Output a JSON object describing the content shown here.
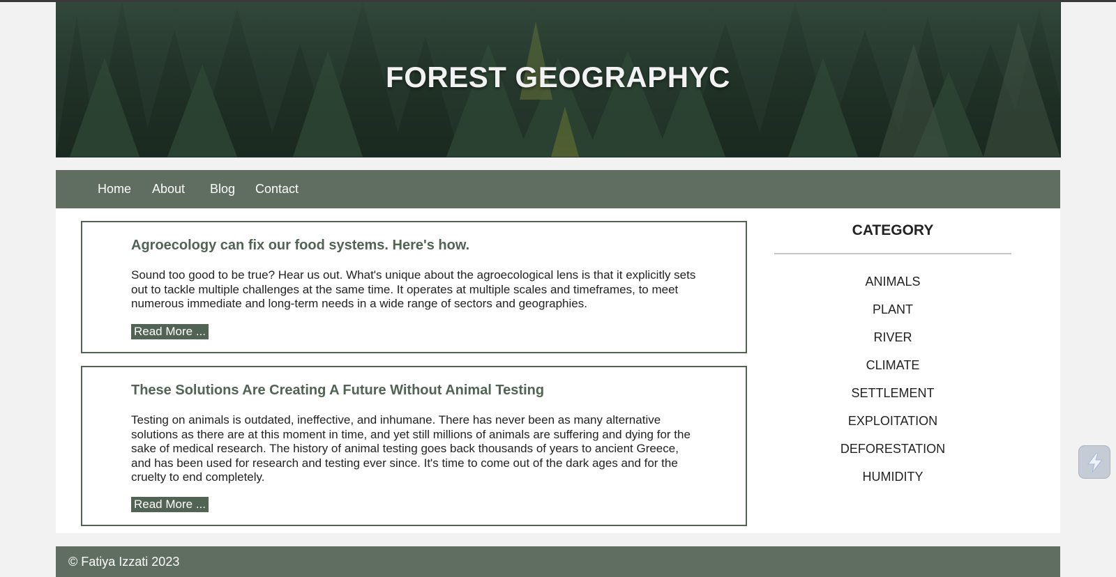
{
  "banner": {
    "title": "FOREST GEOGRAPHYC"
  },
  "nav": {
    "items": [
      "Home",
      "About",
      "Blog",
      "Contact"
    ]
  },
  "posts": [
    {
      "title": "Agroecology can fix our food systems. Here's how.",
      "body": "Sound too good to be true? Hear us out. What's unique about the agroecological lens is that it explicitly sets out to tackle multiple challenges at the same time. It operates at multiple scales and timeframes, to meet numerous immediate and long-term needs in a wide range of sectors and geographies.",
      "button": "Read More ..."
    },
    {
      "title": "These Solutions Are Creating A Future Without Animal Testing",
      "body": "Testing on animals is outdated, ineffective, and inhumane. There has never been as many alternative solutions as there are at this moment in time, and yet still millions of animals are suffering and dying for the sake of medical research. The history of animal testing goes back thousands of years to ancient Greece, and has been used for research and testing ever since. It's time to come out of the dark ages and for the cruelty to end completely.",
      "button": "Read More ..."
    }
  ],
  "sidebar": {
    "title": "CATEGORY",
    "categories": [
      "ANIMALS",
      "PLANT",
      "RIVER",
      "CLIMATE",
      "SETTLEMENT",
      "EXPLOITATION",
      "DEFORESTATION",
      "HUMIDITY"
    ]
  },
  "footer": {
    "text": "© Fatiya Izzati 2023"
  },
  "colors": {
    "accent": "#5f6e61",
    "heading": "#516353",
    "page_bg": "#f2f2f2"
  },
  "floating_widget": {
    "icon": "lightning-icon"
  }
}
